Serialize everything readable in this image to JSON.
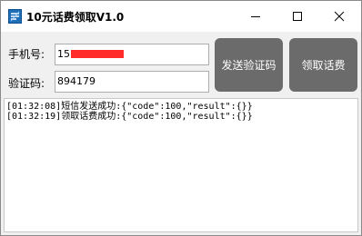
{
  "window": {
    "title": "10元话费领取V1.0"
  },
  "form": {
    "phone_label": "手机号:",
    "phone_value": "15",
    "code_label": "验证码:",
    "code_value": "894179"
  },
  "buttons": {
    "send_code": "发送验证码",
    "claim": "领取话费"
  },
  "log": {
    "lines": [
      "[01:32:08]短信发送成功:{\"code\":100,\"result\":{}}",
      "[01:32:19]领取话费成功:{\"code\":100,\"result\":{}}"
    ]
  },
  "colors": {
    "button_bg": "#6b6b6b",
    "redaction": "#ff2a2a",
    "icon": "#1f6fb8"
  },
  "icons": {
    "app": "app-logo-icon",
    "minimize": "minimize-icon",
    "maximize": "maximize-icon",
    "close": "close-icon"
  }
}
